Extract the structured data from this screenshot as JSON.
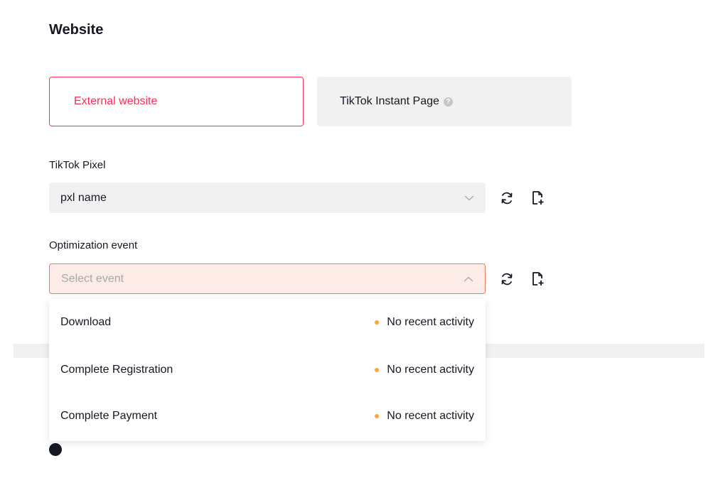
{
  "section": {
    "title": "Website"
  },
  "destination_options": {
    "external": {
      "label": "External website",
      "selected": true
    },
    "instant_page": {
      "label": "TikTok Instant Page",
      "help_icon": "help-icon"
    }
  },
  "pixel": {
    "label": "TikTok Pixel",
    "value": "pxl name",
    "icons": [
      "chevron-down-icon",
      "refresh-icon",
      "add-file-icon"
    ]
  },
  "optimization": {
    "label": "Optimization event",
    "placeholder": "Select event",
    "icons": [
      "chevron-up-icon",
      "refresh-icon",
      "add-file-icon"
    ],
    "options": [
      {
        "label": "Download",
        "status": "No recent activity"
      },
      {
        "label": "Complete Registration",
        "status": "No recent activity"
      },
      {
        "label": "Complete Payment",
        "status": "No recent activity"
      }
    ]
  },
  "colors": {
    "accent": "#fe2c55",
    "error_border": "#ee7a5f",
    "error_bg": "#fdebe7",
    "status_dot": "#f4a83a",
    "neutral_bg": "#f1f1f2"
  }
}
